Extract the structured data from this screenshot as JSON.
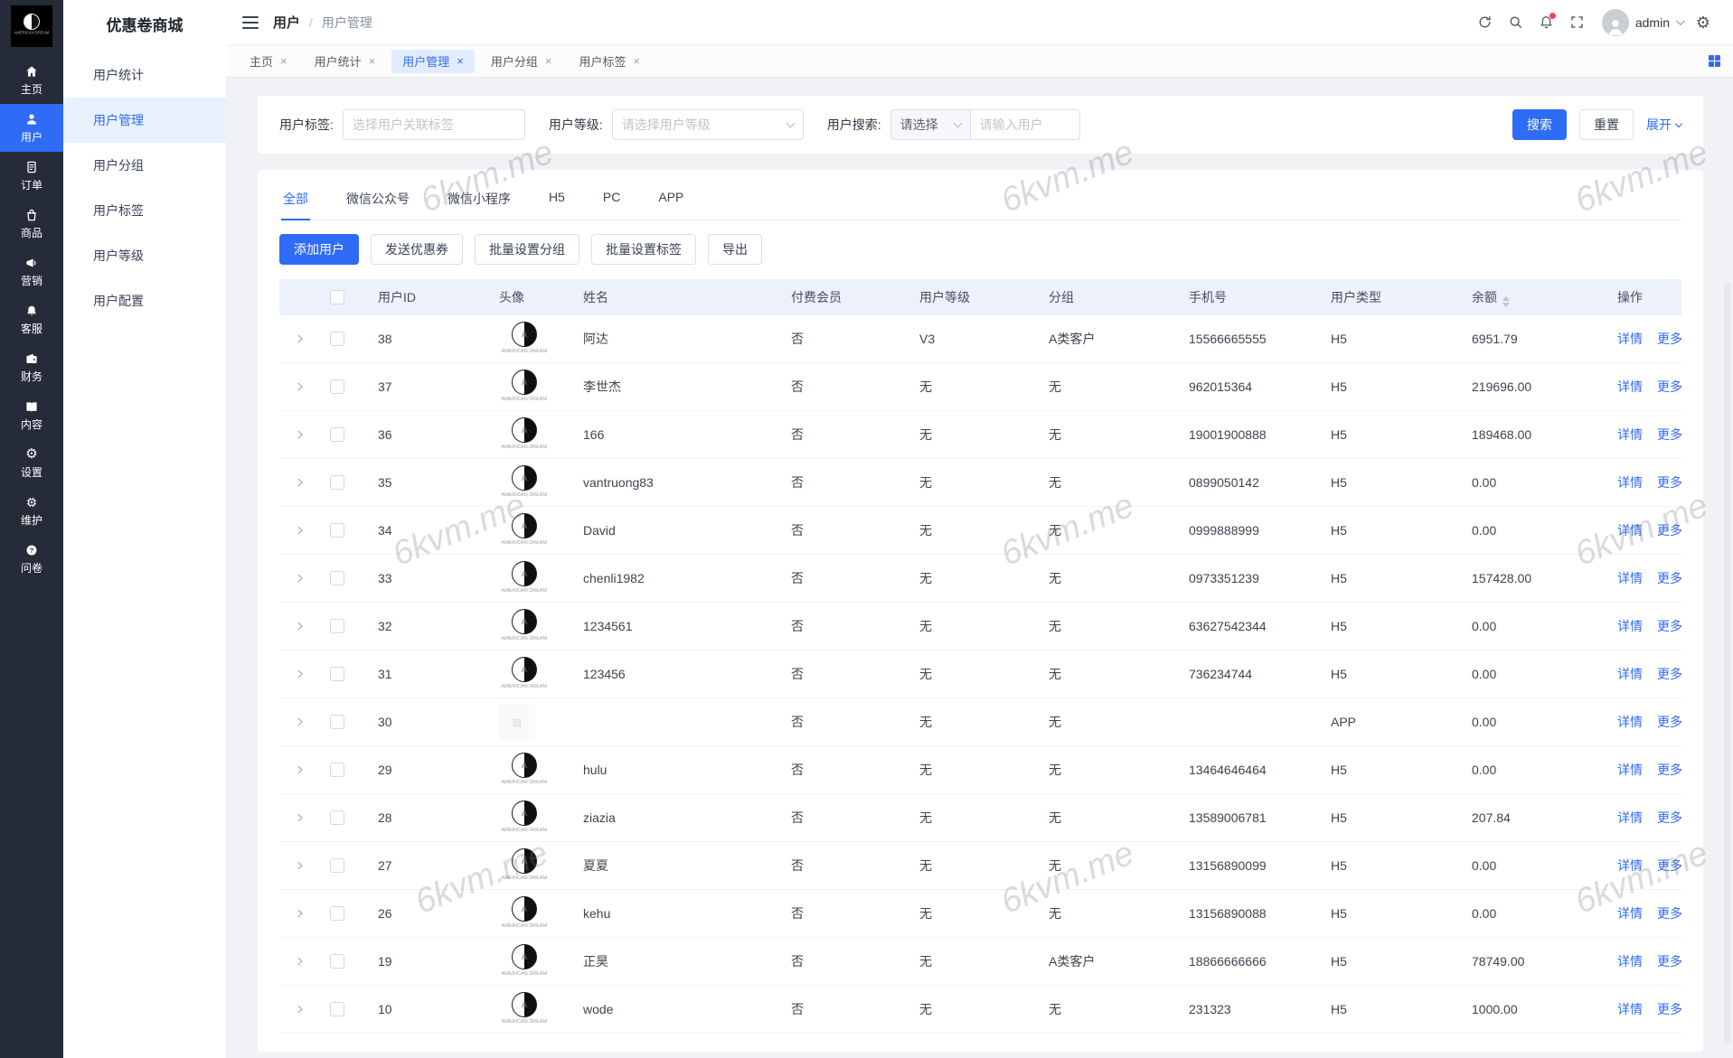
{
  "watermark": {
    "text": "6kvm.me"
  },
  "rail": {
    "logo_caption": "AMERICAN DREAM",
    "items": [
      {
        "label": "主页",
        "icon": "home",
        "active": false
      },
      {
        "label": "用户",
        "icon": "user",
        "active": true
      },
      {
        "label": "订单",
        "icon": "order",
        "active": false
      },
      {
        "label": "商品",
        "icon": "goods",
        "active": false
      },
      {
        "label": "营销",
        "icon": "marketing",
        "active": false
      },
      {
        "label": "客服",
        "icon": "service",
        "active": false
      },
      {
        "label": "财务",
        "icon": "finance",
        "active": false
      },
      {
        "label": "内容",
        "icon": "content",
        "active": false
      },
      {
        "label": "设置",
        "icon": "settings",
        "active": false
      },
      {
        "label": "维护",
        "icon": "maintain",
        "active": false
      },
      {
        "label": "问卷",
        "icon": "survey",
        "active": false
      }
    ]
  },
  "sidebar": {
    "title": "优惠卷商城",
    "items": [
      {
        "label": "用户统计",
        "active": false
      },
      {
        "label": "用户管理",
        "active": true
      },
      {
        "label": "用户分组",
        "active": false
      },
      {
        "label": "用户标签",
        "active": false
      },
      {
        "label": "用户等级",
        "active": false
      },
      {
        "label": "用户配置",
        "active": false
      }
    ]
  },
  "header": {
    "breadcrumb": {
      "root": "用户",
      "sep": "/",
      "current": "用户管理"
    },
    "user": "admin"
  },
  "tabs": [
    {
      "label": "主页",
      "active": false
    },
    {
      "label": "用户统计",
      "active": false
    },
    {
      "label": "用户管理",
      "active": true
    },
    {
      "label": "用户分组",
      "active": false
    },
    {
      "label": "用户标签",
      "active": false
    }
  ],
  "filter": {
    "tag_label": "用户标签:",
    "tag_placeholder": "选择用户关联标签",
    "level_label": "用户等级:",
    "level_placeholder": "请选择用户等级",
    "search_label": "用户搜索:",
    "search_select": "请选择",
    "search_placeholder": "请输入用户",
    "search_btn": "搜索",
    "reset_btn": "重置",
    "expand_btn": "展开"
  },
  "channel_tabs": [
    {
      "label": "全部",
      "active": true
    },
    {
      "label": "微信公众号",
      "active": false
    },
    {
      "label": "微信小程序",
      "active": false
    },
    {
      "label": "H5",
      "active": false
    },
    {
      "label": "PC",
      "active": false
    },
    {
      "label": "APP",
      "active": false
    }
  ],
  "actions": [
    {
      "label": "添加用户",
      "primary": true
    },
    {
      "label": "发送优惠券",
      "primary": false
    },
    {
      "label": "批量设置分组",
      "primary": false
    },
    {
      "label": "批量设置标签",
      "primary": false
    },
    {
      "label": "导出",
      "primary": false
    }
  ],
  "table": {
    "columns": [
      "用户ID",
      "头像",
      "姓名",
      "付费会员",
      "用户等级",
      "分组",
      "手机号",
      "用户类型",
      "余额",
      "操作"
    ],
    "row_actions": {
      "detail": "详情",
      "more": "更多"
    },
    "avatar_caption": "AMERICAN DREAM",
    "rows": [
      {
        "id": "38",
        "name": "阿达",
        "paid": "否",
        "level": "V3",
        "group": "A类客户",
        "phone": "15566665555",
        "type": "H5",
        "balance": "6951.79",
        "avatar": "logo"
      },
      {
        "id": "37",
        "name": "李世杰",
        "paid": "否",
        "level": "无",
        "group": "无",
        "phone": "962015364",
        "type": "H5",
        "balance": "219696.00",
        "avatar": "logo"
      },
      {
        "id": "36",
        "name": "166",
        "paid": "否",
        "level": "无",
        "group": "无",
        "phone": "19001900888",
        "type": "H5",
        "balance": "189468.00",
        "avatar": "logo"
      },
      {
        "id": "35",
        "name": "vantruong83",
        "paid": "否",
        "level": "无",
        "group": "无",
        "phone": "0899050142",
        "type": "H5",
        "balance": "0.00",
        "avatar": "logo"
      },
      {
        "id": "34",
        "name": "David",
        "paid": "否",
        "level": "无",
        "group": "无",
        "phone": "0999888999",
        "type": "H5",
        "balance": "0.00",
        "avatar": "logo"
      },
      {
        "id": "33",
        "name": "chenli1982",
        "paid": "否",
        "level": "无",
        "group": "无",
        "phone": "0973351239",
        "type": "H5",
        "balance": "157428.00",
        "avatar": "logo"
      },
      {
        "id": "32",
        "name": "1234561",
        "paid": "否",
        "level": "无",
        "group": "无",
        "phone": "63627542344",
        "type": "H5",
        "balance": "0.00",
        "avatar": "logo"
      },
      {
        "id": "31",
        "name": "123456",
        "paid": "否",
        "level": "无",
        "group": "无",
        "phone": "736234744",
        "type": "H5",
        "balance": "0.00",
        "avatar": "logo"
      },
      {
        "id": "30",
        "name": "",
        "paid": "否",
        "level": "无",
        "group": "无",
        "phone": "",
        "type": "APP",
        "balance": "0.00",
        "avatar": "broken"
      },
      {
        "id": "29",
        "name": "hulu",
        "paid": "否",
        "level": "无",
        "group": "无",
        "phone": "13464646464",
        "type": "H5",
        "balance": "0.00",
        "avatar": "logo"
      },
      {
        "id": "28",
        "name": "ziazia",
        "paid": "否",
        "level": "无",
        "group": "无",
        "phone": "13589006781",
        "type": "H5",
        "balance": "207.84",
        "avatar": "logo"
      },
      {
        "id": "27",
        "name": "夏夏",
        "paid": "否",
        "level": "无",
        "group": "无",
        "phone": "13156890099",
        "type": "H5",
        "balance": "0.00",
        "avatar": "logo"
      },
      {
        "id": "26",
        "name": "kehu",
        "paid": "否",
        "level": "无",
        "group": "无",
        "phone": "13156890088",
        "type": "H5",
        "balance": "0.00",
        "avatar": "logo"
      },
      {
        "id": "19",
        "name": "正昊",
        "paid": "否",
        "level": "无",
        "group": "A类客户",
        "phone": "18866666666",
        "type": "H5",
        "balance": "78749.00",
        "avatar": "logo"
      },
      {
        "id": "10",
        "name": "wode",
        "paid": "否",
        "level": "无",
        "group": "无",
        "phone": "231323",
        "type": "H5",
        "balance": "1000.00",
        "avatar": "logo"
      }
    ]
  },
  "colors": {
    "primary": "#2e6bf6",
    "rail_bg": "#262b39",
    "thead_bg": "#edf1fb",
    "tab_active_bg": "#e2ecff",
    "danger_dot": "#f5424d"
  }
}
